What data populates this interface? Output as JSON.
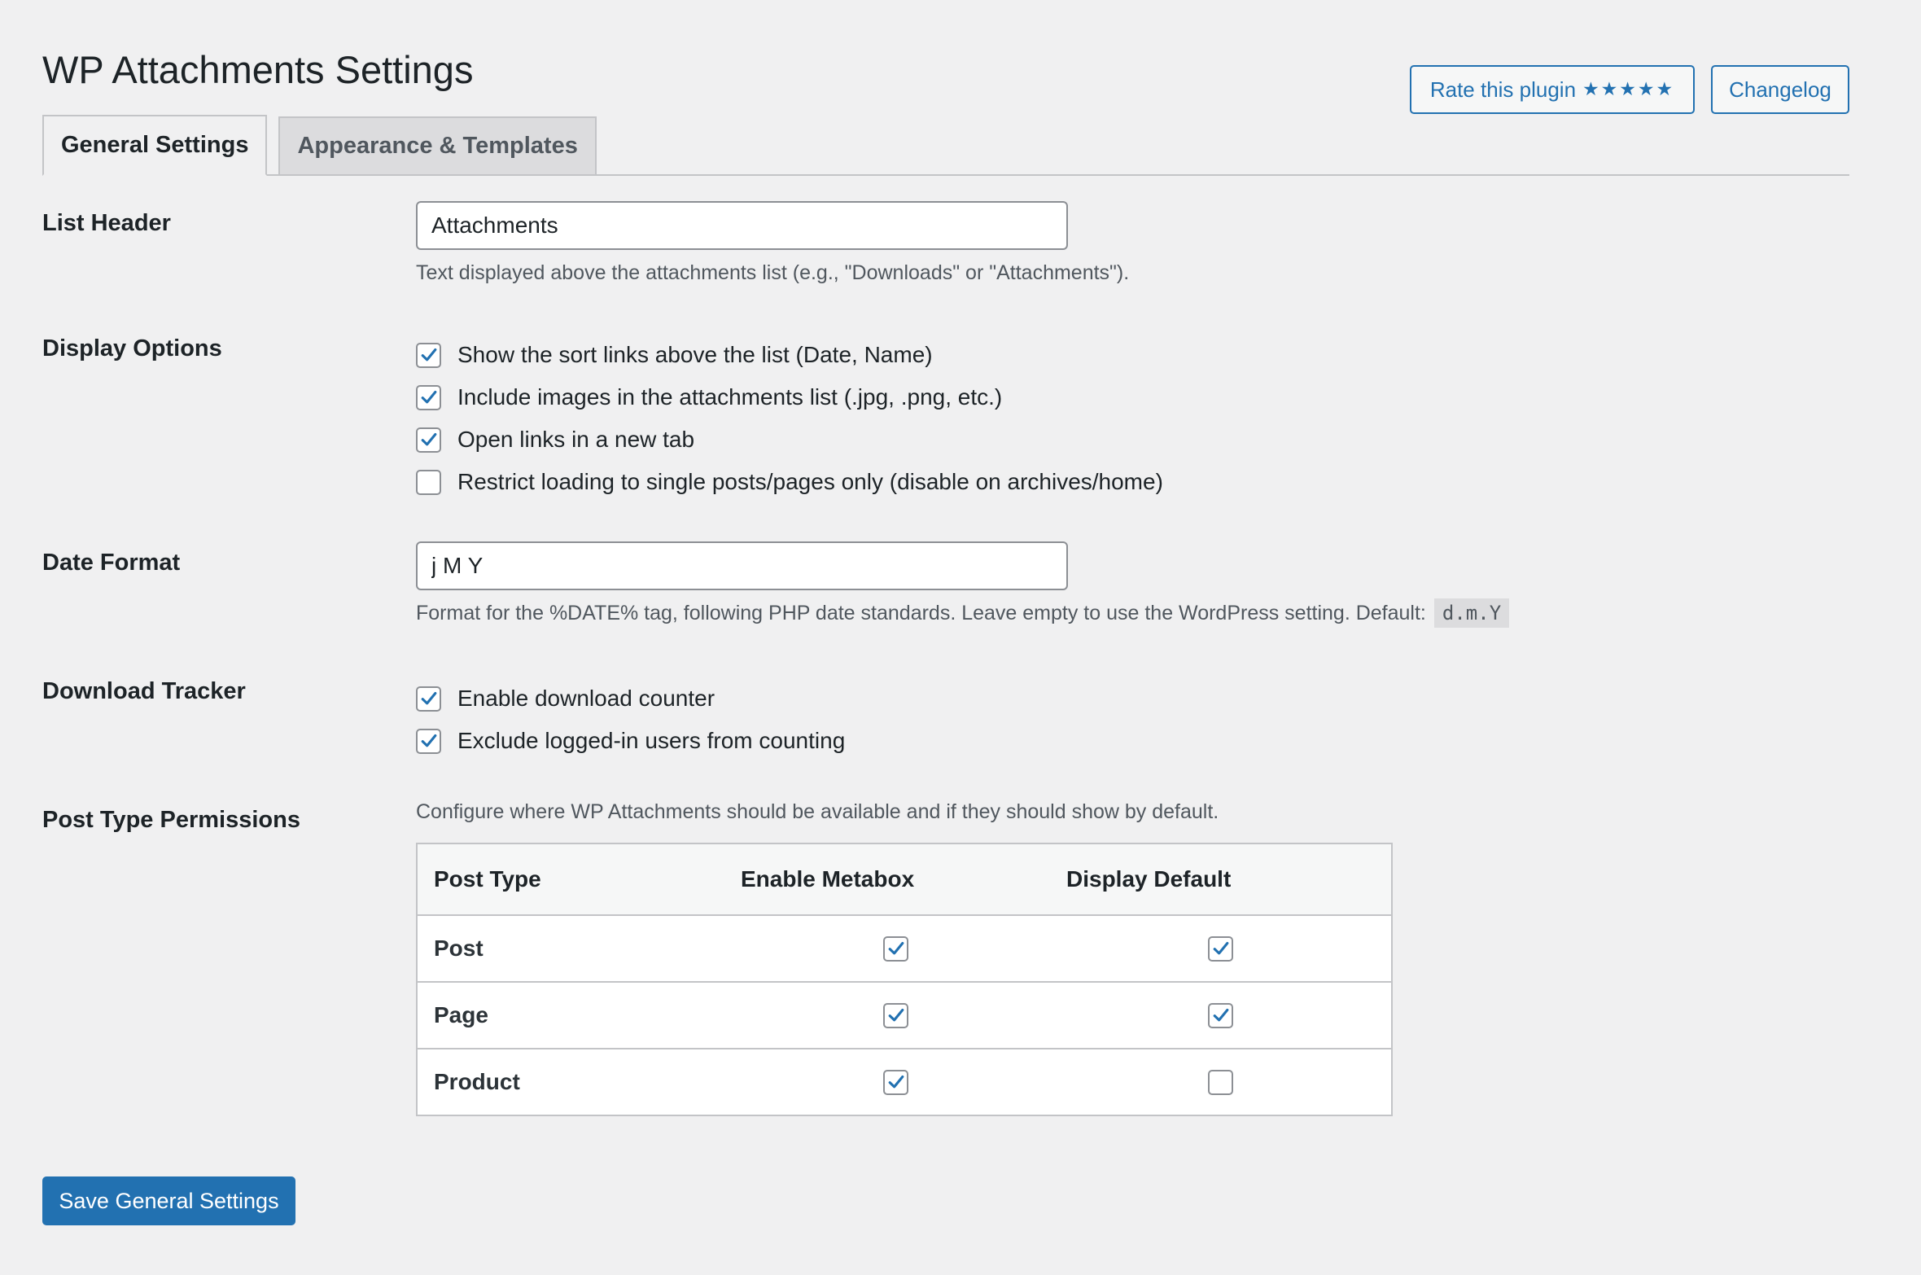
{
  "page": {
    "title": "WP Attachments Settings"
  },
  "header": {
    "rate_label": "Rate this plugin",
    "rate_stars": "★★★★★",
    "changelog_label": "Changelog"
  },
  "tabs": [
    {
      "label": "General Settings",
      "active": true
    },
    {
      "label": "Appearance & Templates",
      "active": false
    }
  ],
  "list_header": {
    "label": "List Header",
    "value": "Attachments",
    "description": "Text displayed above the attachments list (e.g., \"Downloads\" or \"Attachments\")."
  },
  "display_options": {
    "label": "Display Options",
    "items": [
      {
        "label": "Show the sort links above the list (Date, Name)",
        "checked": true
      },
      {
        "label": "Include images in the attachments list (.jpg, .png, etc.)",
        "checked": true
      },
      {
        "label": "Open links in a new tab",
        "checked": true
      },
      {
        "label": "Restrict loading to single posts/pages only (disable on archives/home)",
        "checked": false
      }
    ]
  },
  "date_format": {
    "label": "Date Format",
    "value": "j M Y",
    "description": "Format for the %DATE% tag, following PHP date standards. Leave empty to use the WordPress setting. Default:",
    "default_code": "d.m.Y"
  },
  "download_tracker": {
    "label": "Download Tracker",
    "items": [
      {
        "label": "Enable download counter",
        "checked": true
      },
      {
        "label": "Exclude logged-in users from counting",
        "checked": true
      }
    ]
  },
  "post_type_permissions": {
    "label": "Post Type Permissions",
    "description": "Configure where WP Attachments should be available and if they should show by default.",
    "columns": [
      "Post Type",
      "Enable Metabox",
      "Display Default"
    ],
    "rows": [
      {
        "type": "Post",
        "metabox": true,
        "display_default": true
      },
      {
        "type": "Page",
        "metabox": true,
        "display_default": true
      },
      {
        "type": "Product",
        "metabox": true,
        "display_default": false
      }
    ]
  },
  "save_button": {
    "label": "Save General Settings"
  },
  "colors": {
    "accent": "#2271b1",
    "background": "#f0f0f1",
    "text": "#1d2327",
    "muted": "#50575e",
    "border": "#c3c4c7"
  },
  "icons": {
    "checkmark": "checkmark-icon",
    "star": "star-icon"
  }
}
